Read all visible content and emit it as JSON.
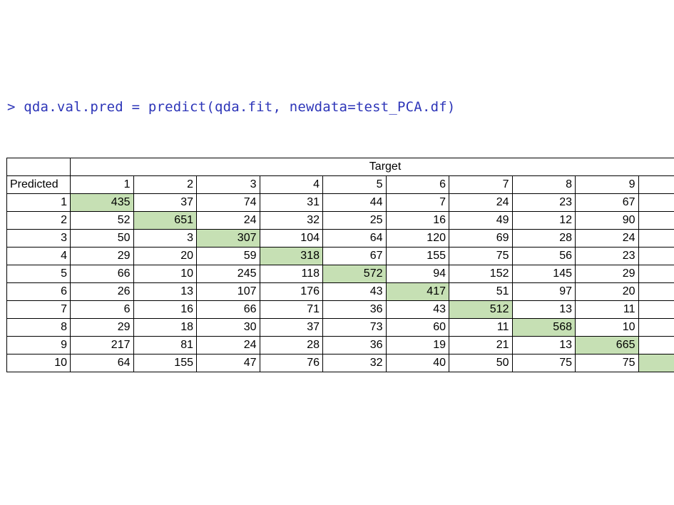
{
  "command": "> qda.val.pred = predict(qda.fit, newdata=test_PCA.df)",
  "colors": {
    "command_text": "#2d35b8",
    "diagonal_highlight": "#c6e0b4"
  },
  "table": {
    "target_label": "Target",
    "predicted_label": "Predicted",
    "columns": [
      "1",
      "2",
      "3",
      "4",
      "5",
      "6",
      "7",
      "8",
      "9",
      ""
    ],
    "rows": [
      {
        "label": "1",
        "cells": [
          "435",
          "37",
          "74",
          "31",
          "44",
          "7",
          "24",
          "23",
          "67",
          ""
        ]
      },
      {
        "label": "2",
        "cells": [
          "52",
          "651",
          "24",
          "32",
          "25",
          "16",
          "49",
          "12",
          "90",
          ""
        ]
      },
      {
        "label": "3",
        "cells": [
          "50",
          "3",
          "307",
          "104",
          "64",
          "120",
          "69",
          "28",
          "24",
          ""
        ]
      },
      {
        "label": "4",
        "cells": [
          "29",
          "20",
          "59",
          "318",
          "67",
          "155",
          "75",
          "56",
          "23",
          ""
        ]
      },
      {
        "label": "5",
        "cells": [
          "66",
          "10",
          "245",
          "118",
          "572",
          "94",
          "152",
          "145",
          "29",
          ""
        ]
      },
      {
        "label": "6",
        "cells": [
          "26",
          "13",
          "107",
          "176",
          "43",
          "417",
          "51",
          "97",
          "20",
          ""
        ]
      },
      {
        "label": "7",
        "cells": [
          "6",
          "16",
          "66",
          "71",
          "36",
          "43",
          "512",
          "13",
          "11",
          ""
        ]
      },
      {
        "label": "8",
        "cells": [
          "29",
          "18",
          "30",
          "37",
          "73",
          "60",
          "11",
          "568",
          "10",
          ""
        ]
      },
      {
        "label": "9",
        "cells": [
          "217",
          "81",
          "24",
          "28",
          "36",
          "19",
          "21",
          "13",
          "665",
          ""
        ]
      },
      {
        "label": "10",
        "cells": [
          "64",
          "155",
          "47",
          "76",
          "32",
          "40",
          "50",
          "75",
          "75",
          ""
        ]
      }
    ]
  }
}
